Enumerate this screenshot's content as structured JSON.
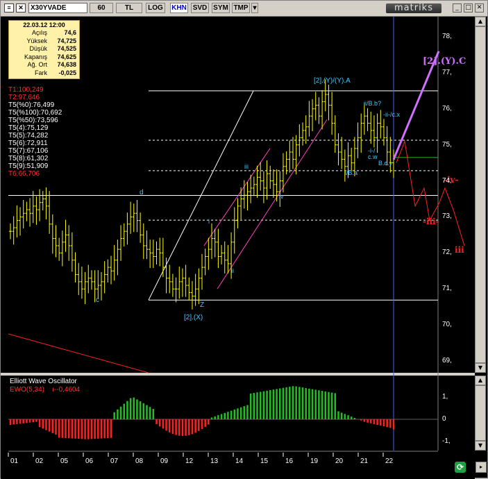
{
  "toolbar": {
    "symbol": "X30YVADE",
    "period": "60",
    "currency": "TL",
    "buttons": [
      "LOG",
      "KHN",
      "SVD",
      "SYM",
      "TMP"
    ],
    "active_button": "KHN",
    "brand": "matriks"
  },
  "stats": {
    "date": "22.03.12 12:00",
    "rows": [
      {
        "label": "Açılış",
        "value": "74,6"
      },
      {
        "label": "Yüksek",
        "value": "74,725"
      },
      {
        "label": "Düşük",
        "value": "74,525"
      },
      {
        "label": "Kapanış",
        "value": "74,625"
      },
      {
        "label": "Ağ. Ort",
        "value": "74,638"
      },
      {
        "label": "Fark",
        "value": "-0,025"
      }
    ]
  },
  "targets": [
    {
      "text": "T1:100,249",
      "color": "#ff3030"
    },
    {
      "text": "T2:97,646",
      "color": "#ff3030"
    },
    {
      "text": "T5(%0):76,499",
      "color": "#ffffff"
    },
    {
      "text": "T5(%100):70,692",
      "color": "#ffffff"
    },
    {
      "text": "T5(%50):73,596",
      "color": "#ffffff"
    },
    {
      "text": "T5(4):75,129",
      "color": "#ffffff"
    },
    {
      "text": "T5(5):74,282",
      "color": "#ffffff"
    },
    {
      "text": "T5(6):72,911",
      "color": "#ffffff"
    },
    {
      "text": "T5(7):67,106",
      "color": "#ffffff"
    },
    {
      "text": "T5(8):61,302",
      "color": "#ffffff"
    },
    {
      "text": "T5(9):51,909",
      "color": "#ffffff"
    },
    {
      "text": "T6:66,706",
      "color": "#ff3030"
    }
  ],
  "colors": {
    "candles": "#ffff00",
    "wave_labels": "#40c8ff",
    "red_wave": "#ff2020",
    "magenta_wave": "#d070ff",
    "channel": "#ff40c0",
    "price_marker": "#4060ff",
    "green_line": "#20c020"
  },
  "wave_labels": [
    {
      "text": "[2].(Y)/(Y).A",
      "color": "#40c8ff",
      "size": 10
    },
    {
      "text": "ii/B.b?",
      "color": "#40c8ff",
      "size": 9
    },
    {
      "text": "-ii-/c.x",
      "color": "#40c8ff",
      "size": 9
    },
    {
      "text": "-i-/",
      "color": "#40c8ff",
      "size": 9
    },
    {
      "text": "c.w",
      "color": "#40c8ff",
      "size": 9
    },
    {
      "text": "B.c.y",
      "color": "#40c8ff",
      "size": 9
    },
    {
      "text": "i/B.a",
      "color": "#40c8ff",
      "size": 9
    },
    {
      "text": "iii",
      "color": "#40c8ff",
      "size": 9
    },
    {
      "text": "iv",
      "color": "#40c8ff",
      "size": 9
    },
    {
      "text": "i",
      "color": "#40c8ff",
      "size": 9
    },
    {
      "text": "ii",
      "color": "#40c8ff",
      "size": 9
    },
    {
      "text": "d",
      "color": "#40c8ff",
      "size": 10
    },
    {
      "text": "c",
      "color": "#40c8ff",
      "size": 10
    },
    {
      "text": "Z",
      "color": "#40c8ff",
      "size": 10
    },
    {
      "text": "[2].(X)",
      "color": "#40c8ff",
      "size": 10
    },
    {
      "text": "[2].(Y).C",
      "color": "#d070ff",
      "size": 13
    },
    {
      "text": "-iv-",
      "color": "#ff2020",
      "size": 12
    },
    {
      "text": "-iii-",
      "color": "#ff2020",
      "size": 12
    },
    {
      "text": "iii",
      "color": "#ff2020",
      "size": 12
    }
  ],
  "chart_data": [
    {
      "type": "candlestick",
      "title": "",
      "price_axis": [
        "78,",
        "77,",
        "76,",
        "75,",
        "74,",
        "73,",
        "72,",
        "71,",
        "70,",
        "69,"
      ],
      "ylim": [
        68.7,
        78.4
      ],
      "x_ticks": [
        "01",
        "02",
        "05",
        "06",
        "07",
        "08",
        "09",
        "12",
        "13",
        "14",
        "15",
        "16",
        "19",
        "20",
        "21",
        "22"
      ],
      "horizontal_levels": [
        {
          "value": 76.499,
          "style": "solid"
        },
        {
          "value": 75.129,
          "style": "dashed"
        },
        {
          "value": 74.282,
          "style": "dashed"
        },
        {
          "value": 73.596,
          "style": "solid"
        },
        {
          "value": 72.911,
          "style": "dashed"
        },
        {
          "value": 70.692,
          "style": "solid"
        }
      ],
      "closes": [
        72.6,
        72.7,
        72.9,
        73.0,
        73.1,
        73.2,
        73.1,
        73.3,
        73.2,
        73.4,
        73.5,
        73.3,
        72.8,
        72.4,
        72.2,
        72.0,
        72.3,
        72.5,
        72.2,
        71.8,
        71.4,
        71.2,
        71.0,
        71.2,
        71.3,
        71.2,
        71.0,
        71.1,
        71.2,
        71.4,
        71.6,
        71.5,
        71.8,
        72.1,
        72.4,
        72.6,
        72.8,
        73.0,
        73.1,
        72.9,
        72.5,
        72.2,
        72.1,
        72.0,
        71.9,
        72.1,
        72.0,
        71.6,
        71.3,
        71.2,
        71.0,
        71.0,
        71.2,
        71.3,
        71.1,
        70.9,
        70.8,
        71.0,
        71.3,
        71.6,
        71.9,
        72.1,
        72.4,
        72.3,
        71.9,
        72.0,
        71.8,
        71.7,
        72.3,
        72.9,
        73.3,
        73.5,
        73.6,
        73.7,
        73.8,
        73.9,
        74.1,
        74.0,
        73.8,
        74.2,
        74.0,
        73.9,
        73.7,
        74.0,
        74.4,
        74.6,
        74.8,
        74.6,
        75.0,
        75.2,
        75.4,
        75.5,
        75.8,
        76.0,
        76.1,
        75.8,
        76.2,
        76.4,
        76.1,
        75.6,
        75.0,
        74.8,
        74.6,
        74.4,
        74.7,
        74.5,
        74.9,
        75.2,
        75.6,
        75.8,
        75.6,
        75.4,
        75.2,
        75.6,
        75.5,
        75.2,
        74.8,
        74.5,
        74.6
      ],
      "series": [
        {
          "name": "Wave projection",
          "x": [
            570,
            582,
            597,
            610,
            618,
            632,
            640,
            652,
            668
          ],
          "y": [
            74.5,
            75.1,
            73.3,
            73.8,
            72.9,
            73.4,
            73.8,
            73.2,
            72.2
          ]
        },
        {
          "name": "Projection (Y).C",
          "x": [
            566,
            631
          ],
          "y": [
            74.6,
            77.6
          ]
        }
      ]
    },
    {
      "type": "bar",
      "title": "Elliott Wave Oscillator",
      "indicator": "EWO(5,34)",
      "last_value": "-0,4604",
      "y_ticks": [
        "1,",
        "0",
        "-1,"
      ],
      "ylim": [
        -1.25,
        1.65
      ],
      "positive_color": "#20c020",
      "negative_color": "#ff2020"
    }
  ]
}
